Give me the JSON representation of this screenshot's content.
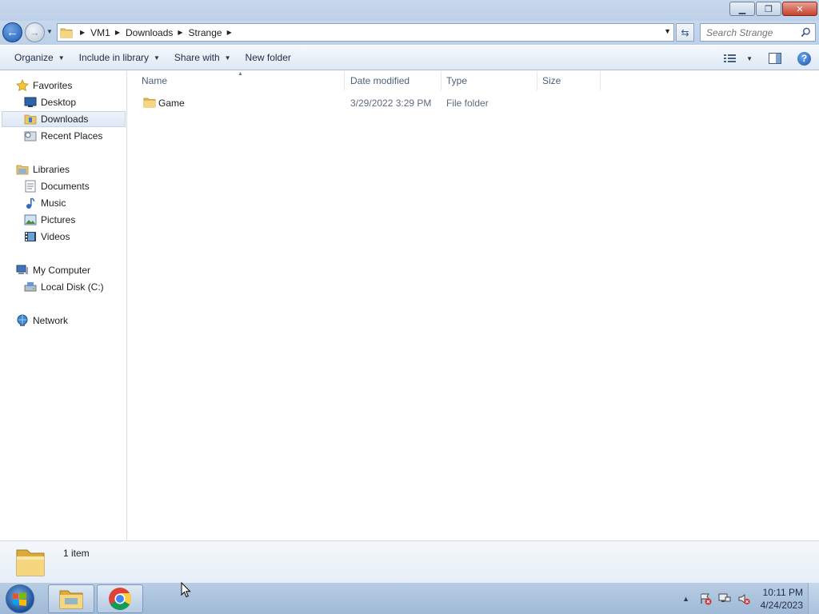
{
  "window": {
    "controls": [
      "minimize",
      "maximize",
      "close"
    ]
  },
  "navigation": {
    "breadcrumbs": [
      "VM1",
      "Downloads",
      "Strange"
    ],
    "search_placeholder": "Search Strange"
  },
  "commandbar": {
    "organize": "Organize",
    "include_in_library": "Include in library",
    "share_with": "Share with",
    "new_folder": "New folder"
  },
  "sidebar": {
    "favorites": {
      "label": "Favorites",
      "items": [
        {
          "label": "Desktop",
          "icon": "desktop-icon"
        },
        {
          "label": "Downloads",
          "icon": "downloads-folder-icon",
          "selected": true
        },
        {
          "label": "Recent Places",
          "icon": "recent-places-icon"
        }
      ]
    },
    "libraries": {
      "label": "Libraries",
      "items": [
        {
          "label": "Documents",
          "icon": "documents-icon"
        },
        {
          "label": "Music",
          "icon": "music-icon"
        },
        {
          "label": "Pictures",
          "icon": "pictures-icon"
        },
        {
          "label": "Videos",
          "icon": "videos-icon"
        }
      ]
    },
    "computer": {
      "label": "My Computer",
      "items": [
        {
          "label": "Local Disk (C:)",
          "icon": "local-disk-icon"
        }
      ]
    },
    "network": {
      "label": "Network"
    }
  },
  "files": {
    "columns": [
      "Name",
      "Date modified",
      "Type",
      "Size"
    ],
    "rows": [
      {
        "name": "Game",
        "date_modified": "3/29/2022 3:29 PM",
        "type": "File folder",
        "size": ""
      }
    ]
  },
  "details": {
    "count": "1 item"
  },
  "taskbar": {
    "time": "10:11 PM",
    "date": "4/24/2023",
    "pinned": [
      "windows-explorer-icon",
      "chrome-icon"
    ]
  }
}
